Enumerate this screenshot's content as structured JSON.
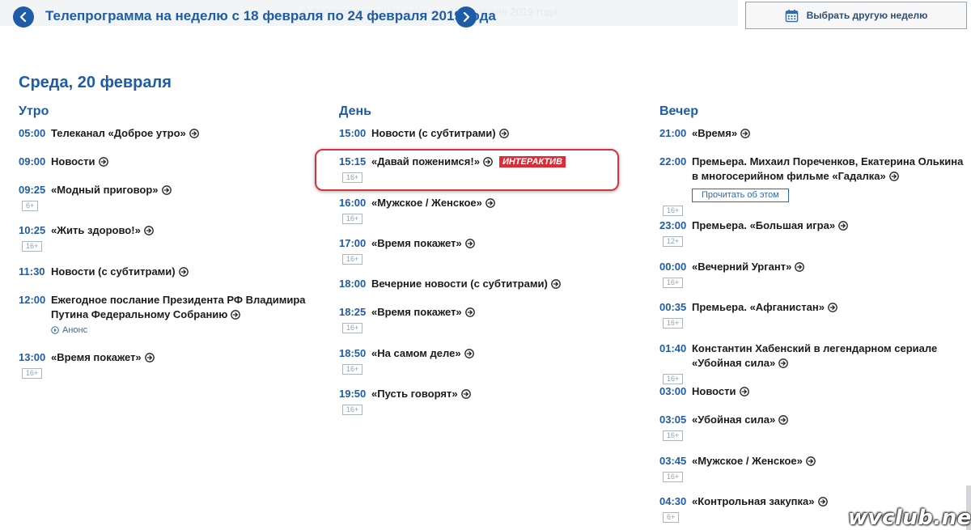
{
  "header": {
    "week_title": "Телепрограмма на неделю с 18 февраля по 24 февраля 2019 года",
    "ghost_text": "…ю телепрограмму на вторник, 19 февраля 2019 года",
    "prev_icon": "chevron-left-icon",
    "next_icon": "chevron-right-icon",
    "select_week_label": "Выбрать другую неделю",
    "calendar_icon": "calendar-icon"
  },
  "day": {
    "title": "Среда, 20 февраля"
  },
  "columns": {
    "morning": {
      "title": "Утро",
      "items": [
        {
          "time": "05:00",
          "name": "Телеканал «Доброе утро»"
        },
        {
          "time": "09:00",
          "name": "Новости"
        },
        {
          "time": "09:25",
          "name": "«Модный приговор»",
          "age": "6+"
        },
        {
          "time": "10:25",
          "name": "«Жить здорово!»",
          "age": "16+"
        },
        {
          "time": "11:30",
          "name": "Новости (с субтитрами)"
        },
        {
          "time": "12:00",
          "name": "Ежегодное послание Президента РФ Владимира Путина Федеральному Собранию",
          "link": "Анонс"
        },
        {
          "time": "13:00",
          "name": "«Время покажет»",
          "age": "16+"
        }
      ]
    },
    "day": {
      "title": "День",
      "items": [
        {
          "time": "15:00",
          "name": "Новости (с субтитрами)"
        },
        {
          "time": "15:15",
          "name": "«Давай поженимся!»",
          "age": "16+",
          "badge": "ИНТЕРАКТИВ"
        },
        {
          "time": "16:00",
          "name": "«Мужское / Женское»",
          "age": "16+"
        },
        {
          "time": "17:00",
          "name": "«Время покажет»",
          "age": "16+"
        },
        {
          "time": "18:00",
          "name": "Вечерние новости (с субтитрами)"
        },
        {
          "time": "18:25",
          "name": "«Время покажет»",
          "age": "16+"
        },
        {
          "time": "18:50",
          "name": "«На самом деле»",
          "age": "16+"
        },
        {
          "time": "19:50",
          "name": "«Пусть говорят»",
          "age": "16+"
        }
      ]
    },
    "evening": {
      "title": "Вечер",
      "items": [
        {
          "time": "21:00",
          "name": "«Время»"
        },
        {
          "time": "22:00",
          "name": "Премьера. Михаил Пореченков, Екатерина Олькина в многосерийном фильме «Гадалка»",
          "age": "16+",
          "button": "Прочитать об этом"
        },
        {
          "time": "23:00",
          "name": "Премьера. «Большая игра»",
          "age": "12+"
        },
        {
          "time": "00:00",
          "name": "«Вечерний Ургант»",
          "age": "16+"
        },
        {
          "time": "00:35",
          "name": "Премьера. «Афганистан»",
          "age": "16+"
        },
        {
          "time": "01:40",
          "name": "Константин Хабенский в легендарном сериале «Убойная сила»",
          "age": "16+"
        },
        {
          "time": "03:00",
          "name": "Новости"
        },
        {
          "time": "03:05",
          "name": "«Убойная сила»",
          "age": "16+"
        },
        {
          "time": "03:45",
          "name": "«Мужское / Женское»",
          "age": "16+"
        },
        {
          "time": "04:30",
          "name": "«Контрольная закупка»",
          "age": "6+"
        }
      ]
    }
  },
  "watermark": "wvclub.net",
  "colors": {
    "accent": "#1f5ca8",
    "badge": "#e02a36",
    "highlight_border": "#d6333c"
  }
}
